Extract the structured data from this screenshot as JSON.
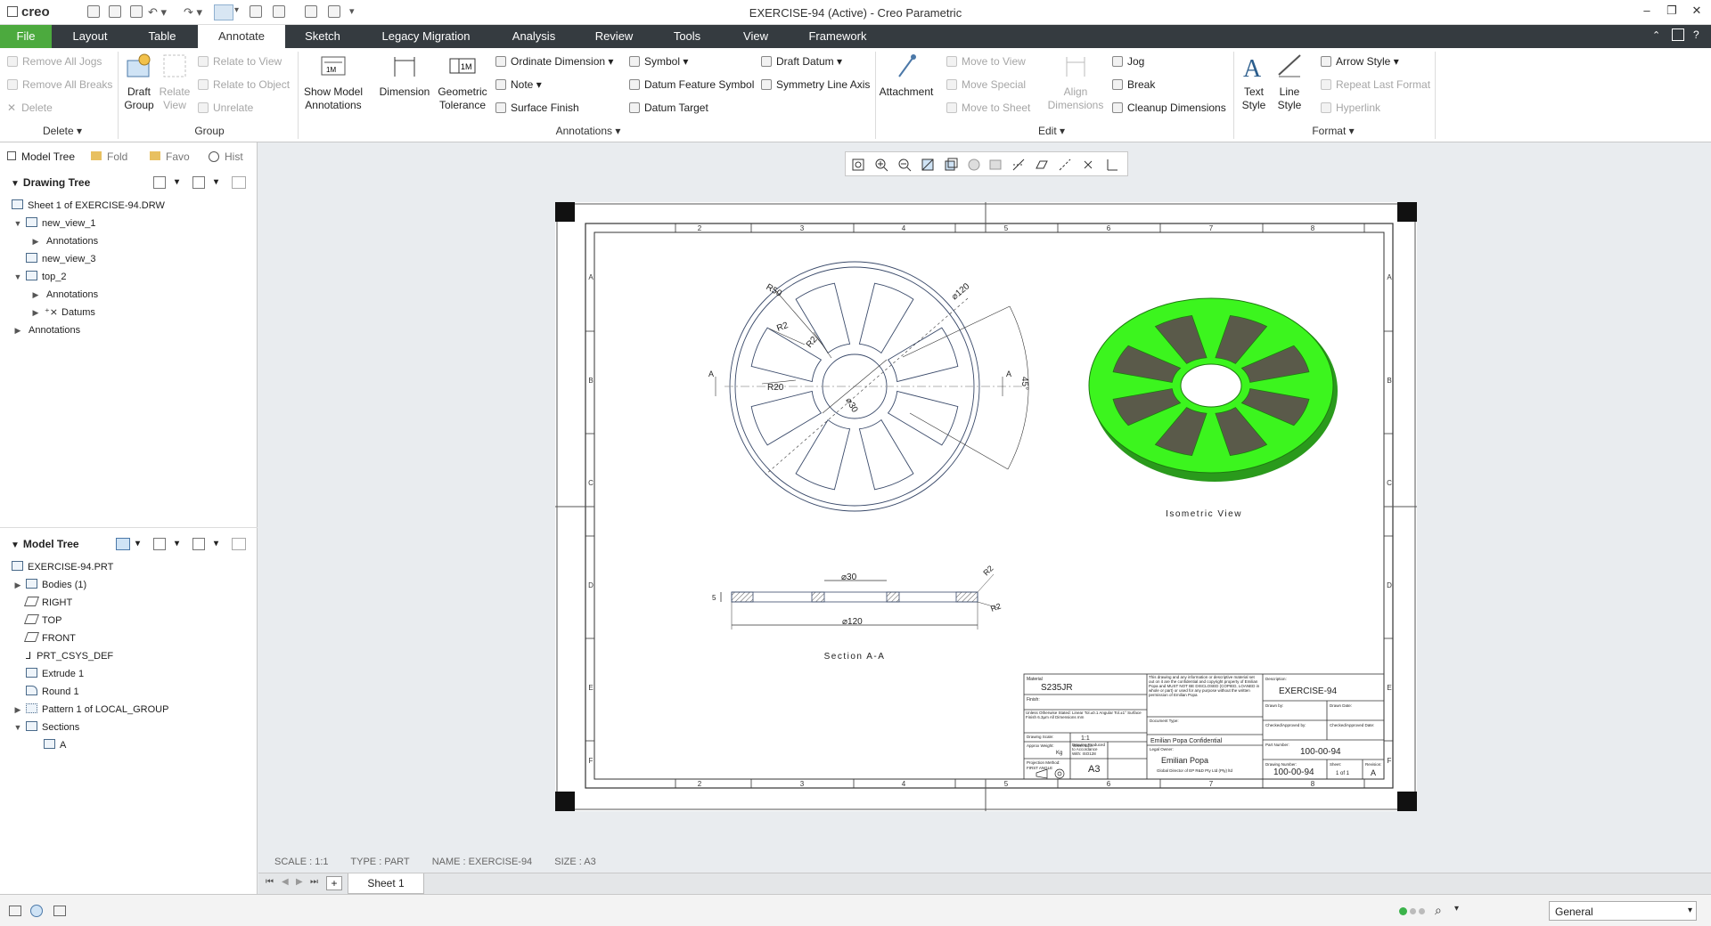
{
  "app": {
    "logo": "creo",
    "window_title": "EXERCISE-94 (Active) - Creo Parametric"
  },
  "menu": {
    "tabs": [
      "File",
      "Layout",
      "Table",
      "Annotate",
      "Sketch",
      "Legacy Migration",
      "Analysis",
      "Review",
      "Tools",
      "View",
      "Framework"
    ],
    "active": "Annotate"
  },
  "ribbon": {
    "delete": {
      "remove_all_jogs": "Remove All Jogs",
      "remove_all_breaks": "Remove All Breaks",
      "delete": "Delete",
      "label": "Delete"
    },
    "group": {
      "draft_group": "Draft Group",
      "relate_view": "Relate View",
      "relate_to_view": "Relate to View",
      "relate_to_object": "Relate to Object",
      "unrelate": "Unrelate",
      "label": "Group"
    },
    "annotations": {
      "show_model_annotations": "Show Model Annotations",
      "dimension": "Dimension",
      "geometric_tolerance": "Geometric Tolerance",
      "ordinate_dimension": "Ordinate Dimension",
      "note": "Note",
      "surface_finish": "Surface Finish",
      "symbol": "Symbol",
      "datum_feature_symbol": "Datum Feature Symbol",
      "datum_target": "Datum Target",
      "draft_datum": "Draft Datum",
      "symmetry_line_axis": "Symmetry Line Axis",
      "label": "Annotations"
    },
    "edit": {
      "attachment": "Attachment",
      "move_to_view": "Move to View",
      "move_special": "Move Special",
      "move_to_sheet": "Move to Sheet",
      "align_dimensions": "Align Dimensions",
      "jog": "Jog",
      "break": "Break",
      "cleanup_dimensions": "Cleanup Dimensions",
      "label": "Edit"
    },
    "format": {
      "text_style": "Text Style",
      "line_style": "Line Style",
      "arrow_style": "Arrow Style",
      "repeat_last_format": "Repeat Last Format",
      "hyperlink": "Hyperlink",
      "label": "Format"
    }
  },
  "panel_tabs": [
    "Model Tree",
    "Fold",
    "Favo",
    "Hist"
  ],
  "drawing_tree": {
    "title": "Drawing Tree",
    "items": [
      "Sheet 1 of EXERCISE-94.DRW",
      "new_view_1",
      "Annotations",
      "new_view_3",
      "top_2",
      "Annotations",
      "Datums",
      "Annotations"
    ]
  },
  "model_tree": {
    "title": "Model Tree",
    "items": [
      "EXERCISE-94.PRT",
      "Bodies (1)",
      "RIGHT",
      "TOP",
      "FRONT",
      "PRT_CSYS_DEF",
      "Extrude 1",
      "Round 1",
      "Pattern 1 of LOCAL_GROUP",
      "Sections",
      "A"
    ]
  },
  "drawing": {
    "col_labels": [
      "1",
      "2",
      "3",
      "4",
      "5",
      "6",
      "7",
      "8"
    ],
    "row_labels": [
      "A",
      "B",
      "C",
      "D",
      "E",
      "F"
    ],
    "dims": {
      "r50": "R50",
      "r2a": "R2",
      "r2b": "R2",
      "r20": "R20",
      "d30": "⌀30",
      "d120": "⌀120",
      "angle": "45°",
      "sec_a": "A",
      "sec_d30": "⌀30",
      "sec_d120": "⌀120",
      "sec_5": "5",
      "sec_r2a": "R2",
      "sec_r2b": "R2"
    },
    "isometric_label": "Isometric View",
    "section_label": "Section A-A",
    "titleblock": {
      "material_caption": "Material",
      "material": "S235JR",
      "finish_caption": "Finish:",
      "tolerance_note": "Unless Otherwise Stated: Linear Tol.±0.1 Angular Tol.±1° Surface Finish 6.3µm All Dimensions mm",
      "scale_caption": "Drawing Scale:",
      "scale": "1:1",
      "weight_caption": "Approx Weight:",
      "weight": "Kg",
      "produced_note": "Drawing Produced to Accordance With: ISO128",
      "projection_caption": "Projection Method:",
      "projection": "FIRST ANGLE",
      "sheet_size_caption": "Sheet Size:",
      "sheet_size": "A3",
      "confidential_note": "This drawing and any information or descriptive material set out on it are the confidential and copyright property of Emilian Popa and MUST NOT BE DISCLOSED (COPIED, LOANED in whole or part) or used for any purpose without the written permission of Emilian Popa",
      "document_type_caption": "Document Type:",
      "confidential": "Emilian Popa Confidential",
      "legal_owner_caption": "Legal Owner:",
      "owner": "Emilian Popa",
      "owner_note": "Global Director of EP R&D Pty Ltd (Pty) ltd",
      "description_caption": "Description:",
      "description": "EXERCISE-94",
      "drawn_by_caption": "Drawn by:",
      "drawn_date_caption": "Drawn Date:",
      "checked_caption": "Checked/Approved by:",
      "checked_date_caption": "Checked/Approved Date:",
      "part_number_caption": "Part Number:",
      "part_number": "100-00-94",
      "drawing_number_caption": "Drawing Number:",
      "drawing_number": "100-00-94",
      "sheet_caption": "Sheet:",
      "sheet": "1 of 1",
      "revision_caption": "Revision:",
      "revision": "A"
    }
  },
  "status_line": {
    "scale": "SCALE : 1:1",
    "type": "TYPE : PART",
    "name": "NAME : EXERCISE-94",
    "size": "SIZE : A3"
  },
  "sheet_tab": "Sheet 1",
  "filter": {
    "value": "General"
  },
  "colors": {
    "accent_green": "#4caa3e",
    "menubar": "#353b40",
    "model_green": "#39f21c"
  }
}
